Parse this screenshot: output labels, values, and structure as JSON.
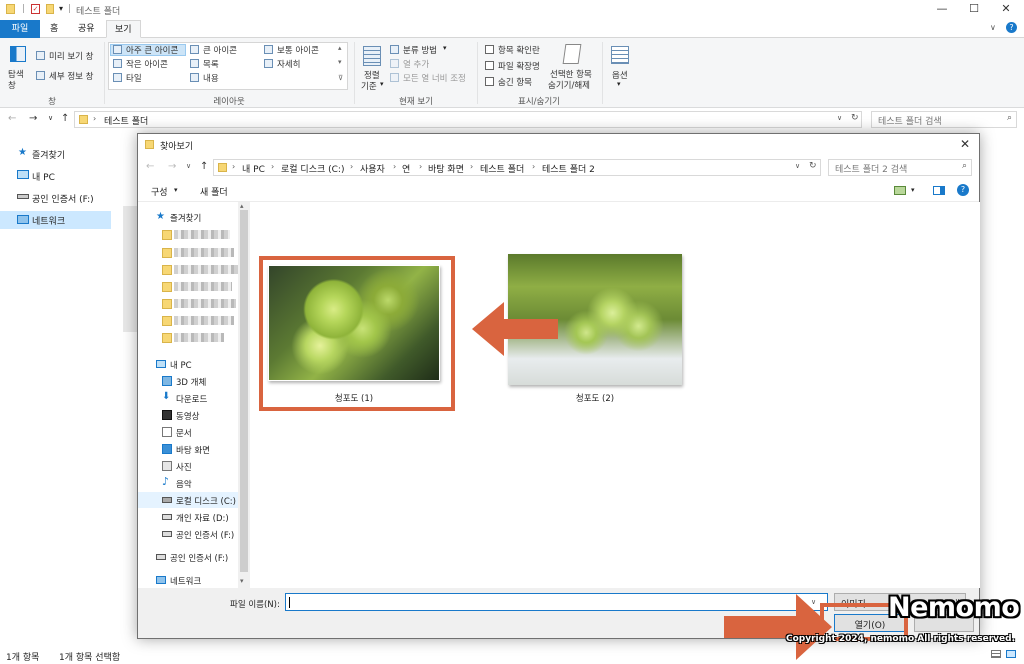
{
  "window": {
    "title": "테스트 폴더",
    "controls": {
      "minimize": "—",
      "maximize": "☐",
      "close": "✕"
    }
  },
  "ribbon_tabs": {
    "file": "파일",
    "home": "홈",
    "share": "공유",
    "view": "보기"
  },
  "ribbon": {
    "panes": {
      "nav_pane_1": "탐색",
      "nav_pane_2": "창",
      "preview": "미리 보기 창",
      "details": "세부 정보 창",
      "group": "창"
    },
    "layout": {
      "extra_large": "아주 큰 아이콘",
      "large": "큰 아이콘",
      "medium": "보통 아이콘",
      "small": "작은 아이콘",
      "list": "목록",
      "details": "자세히",
      "tiles": "타일",
      "content": "내용",
      "group": "레이아웃"
    },
    "current_view": {
      "sort_1": "정렬",
      "sort_2": "기준",
      "group_by": "분류 방법",
      "add_column": "열 추가",
      "fit_columns": "모든 열 너비 조정",
      "group": "현재 보기"
    },
    "show_hide": {
      "item_checkbox": "항목 확인란",
      "file_ext": "파일 확장명",
      "hidden_items": "숨긴 항목",
      "hide_selected_1": "선택한 항목",
      "hide_selected_2": "숨기기/해제",
      "group": "표시/숨기기"
    },
    "options": "옵션"
  },
  "address": {
    "path": "테스트 폴더",
    "search_placeholder": "테스트 폴더 검색"
  },
  "nav": {
    "quick_access": "즐겨찾기",
    "this_pc": "내 PC",
    "cert_drive": "공인 인증서 (F:)",
    "network": "네트워크"
  },
  "status": {
    "count": "1개 항목",
    "selected": "1개 항목 선택함"
  },
  "dialog": {
    "title": "찾아보기",
    "breadcrumb": [
      "내 PC",
      "로컬 디스크 (C:)",
      "사용자",
      "연",
      "바탕 화면",
      "테스트 폴더",
      "테스트 폴더 2"
    ],
    "search_placeholder": "테스트 폴더 2 검색",
    "organize": "구성",
    "new_folder": "새 폴더",
    "tree": {
      "quick_access": "즐겨찾기",
      "this_pc": "내 PC",
      "objects3d": "3D 개체",
      "downloads": "다운로드",
      "videos": "동영상",
      "documents": "문서",
      "desktop": "바탕 화면",
      "pictures": "사진",
      "music": "음악",
      "local_c": "로컬 디스크 (C:)",
      "personal_d": "개인 자료 (D:)",
      "cert_f": "공인 인증서 (F:)",
      "cert_f2": "공인 인증서 (F:)",
      "network": "네트워크"
    },
    "files": [
      {
        "name": "청포도 (1)"
      },
      {
        "name": "청포도 (2)"
      }
    ],
    "filename_label": "파일 이름(N):",
    "filename_value": "",
    "filetype": "이미지",
    "open_button": "열기(O)"
  },
  "watermark": {
    "brand": "Nemomo",
    "copyright": "Copyright 2024, nemomo All rights reserved."
  },
  "colors": {
    "accent": "#1979ca",
    "highlight": "#d9643f",
    "selection": "#cce8ff"
  }
}
